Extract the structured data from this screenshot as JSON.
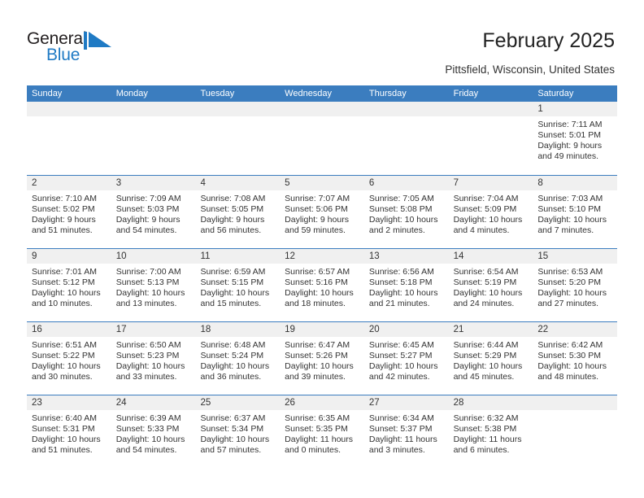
{
  "brand": {
    "name_top": "General",
    "name_bottom": "Blue",
    "accent_color": "#1f7ac4",
    "dark_color": "#231f20",
    "mark": "triangle-flag-mark"
  },
  "header": {
    "title": "February 2025",
    "location": "Pittsfield, Wisconsin, United States"
  },
  "theme": {
    "header_row_bg": "#3b7dbf",
    "day_band_bg": "#f0f0f0",
    "grid_line": "#3b7dbf",
    "text_color": "#333333"
  },
  "weekdays": [
    "Sunday",
    "Monday",
    "Tuesday",
    "Wednesday",
    "Thursday",
    "Friday",
    "Saturday"
  ],
  "weeks": [
    [
      {
        "day": "",
        "empty": true
      },
      {
        "day": "",
        "empty": true
      },
      {
        "day": "",
        "empty": true
      },
      {
        "day": "",
        "empty": true
      },
      {
        "day": "",
        "empty": true
      },
      {
        "day": "",
        "empty": true
      },
      {
        "day": "1",
        "sunrise": "Sunrise: 7:11 AM",
        "sunset": "Sunset: 5:01 PM",
        "daylight_line1": "Daylight: 9 hours",
        "daylight_line2": "and 49 minutes."
      }
    ],
    [
      {
        "day": "2",
        "sunrise": "Sunrise: 7:10 AM",
        "sunset": "Sunset: 5:02 PM",
        "daylight_line1": "Daylight: 9 hours",
        "daylight_line2": "and 51 minutes."
      },
      {
        "day": "3",
        "sunrise": "Sunrise: 7:09 AM",
        "sunset": "Sunset: 5:03 PM",
        "daylight_line1": "Daylight: 9 hours",
        "daylight_line2": "and 54 minutes."
      },
      {
        "day": "4",
        "sunrise": "Sunrise: 7:08 AM",
        "sunset": "Sunset: 5:05 PM",
        "daylight_line1": "Daylight: 9 hours",
        "daylight_line2": "and 56 minutes."
      },
      {
        "day": "5",
        "sunrise": "Sunrise: 7:07 AM",
        "sunset": "Sunset: 5:06 PM",
        "daylight_line1": "Daylight: 9 hours",
        "daylight_line2": "and 59 minutes."
      },
      {
        "day": "6",
        "sunrise": "Sunrise: 7:05 AM",
        "sunset": "Sunset: 5:08 PM",
        "daylight_line1": "Daylight: 10 hours",
        "daylight_line2": "and 2 minutes."
      },
      {
        "day": "7",
        "sunrise": "Sunrise: 7:04 AM",
        "sunset": "Sunset: 5:09 PM",
        "daylight_line1": "Daylight: 10 hours",
        "daylight_line2": "and 4 minutes."
      },
      {
        "day": "8",
        "sunrise": "Sunrise: 7:03 AM",
        "sunset": "Sunset: 5:10 PM",
        "daylight_line1": "Daylight: 10 hours",
        "daylight_line2": "and 7 minutes."
      }
    ],
    [
      {
        "day": "9",
        "sunrise": "Sunrise: 7:01 AM",
        "sunset": "Sunset: 5:12 PM",
        "daylight_line1": "Daylight: 10 hours",
        "daylight_line2": "and 10 minutes."
      },
      {
        "day": "10",
        "sunrise": "Sunrise: 7:00 AM",
        "sunset": "Sunset: 5:13 PM",
        "daylight_line1": "Daylight: 10 hours",
        "daylight_line2": "and 13 minutes."
      },
      {
        "day": "11",
        "sunrise": "Sunrise: 6:59 AM",
        "sunset": "Sunset: 5:15 PM",
        "daylight_line1": "Daylight: 10 hours",
        "daylight_line2": "and 15 minutes."
      },
      {
        "day": "12",
        "sunrise": "Sunrise: 6:57 AM",
        "sunset": "Sunset: 5:16 PM",
        "daylight_line1": "Daylight: 10 hours",
        "daylight_line2": "and 18 minutes."
      },
      {
        "day": "13",
        "sunrise": "Sunrise: 6:56 AM",
        "sunset": "Sunset: 5:18 PM",
        "daylight_line1": "Daylight: 10 hours",
        "daylight_line2": "and 21 minutes."
      },
      {
        "day": "14",
        "sunrise": "Sunrise: 6:54 AM",
        "sunset": "Sunset: 5:19 PM",
        "daylight_line1": "Daylight: 10 hours",
        "daylight_line2": "and 24 minutes."
      },
      {
        "day": "15",
        "sunrise": "Sunrise: 6:53 AM",
        "sunset": "Sunset: 5:20 PM",
        "daylight_line1": "Daylight: 10 hours",
        "daylight_line2": "and 27 minutes."
      }
    ],
    [
      {
        "day": "16",
        "sunrise": "Sunrise: 6:51 AM",
        "sunset": "Sunset: 5:22 PM",
        "daylight_line1": "Daylight: 10 hours",
        "daylight_line2": "and 30 minutes."
      },
      {
        "day": "17",
        "sunrise": "Sunrise: 6:50 AM",
        "sunset": "Sunset: 5:23 PM",
        "daylight_line1": "Daylight: 10 hours",
        "daylight_line2": "and 33 minutes."
      },
      {
        "day": "18",
        "sunrise": "Sunrise: 6:48 AM",
        "sunset": "Sunset: 5:24 PM",
        "daylight_line1": "Daylight: 10 hours",
        "daylight_line2": "and 36 minutes."
      },
      {
        "day": "19",
        "sunrise": "Sunrise: 6:47 AM",
        "sunset": "Sunset: 5:26 PM",
        "daylight_line1": "Daylight: 10 hours",
        "daylight_line2": "and 39 minutes."
      },
      {
        "day": "20",
        "sunrise": "Sunrise: 6:45 AM",
        "sunset": "Sunset: 5:27 PM",
        "daylight_line1": "Daylight: 10 hours",
        "daylight_line2": "and 42 minutes."
      },
      {
        "day": "21",
        "sunrise": "Sunrise: 6:44 AM",
        "sunset": "Sunset: 5:29 PM",
        "daylight_line1": "Daylight: 10 hours",
        "daylight_line2": "and 45 minutes."
      },
      {
        "day": "22",
        "sunrise": "Sunrise: 6:42 AM",
        "sunset": "Sunset: 5:30 PM",
        "daylight_line1": "Daylight: 10 hours",
        "daylight_line2": "and 48 minutes."
      }
    ],
    [
      {
        "day": "23",
        "sunrise": "Sunrise: 6:40 AM",
        "sunset": "Sunset: 5:31 PM",
        "daylight_line1": "Daylight: 10 hours",
        "daylight_line2": "and 51 minutes."
      },
      {
        "day": "24",
        "sunrise": "Sunrise: 6:39 AM",
        "sunset": "Sunset: 5:33 PM",
        "daylight_line1": "Daylight: 10 hours",
        "daylight_line2": "and 54 minutes."
      },
      {
        "day": "25",
        "sunrise": "Sunrise: 6:37 AM",
        "sunset": "Sunset: 5:34 PM",
        "daylight_line1": "Daylight: 10 hours",
        "daylight_line2": "and 57 minutes."
      },
      {
        "day": "26",
        "sunrise": "Sunrise: 6:35 AM",
        "sunset": "Sunset: 5:35 PM",
        "daylight_line1": "Daylight: 11 hours",
        "daylight_line2": "and 0 minutes."
      },
      {
        "day": "27",
        "sunrise": "Sunrise: 6:34 AM",
        "sunset": "Sunset: 5:37 PM",
        "daylight_line1": "Daylight: 11 hours",
        "daylight_line2": "and 3 minutes."
      },
      {
        "day": "28",
        "sunrise": "Sunrise: 6:32 AM",
        "sunset": "Sunset: 5:38 PM",
        "daylight_line1": "Daylight: 11 hours",
        "daylight_line2": "and 6 minutes."
      },
      {
        "day": "",
        "empty": true
      }
    ]
  ]
}
